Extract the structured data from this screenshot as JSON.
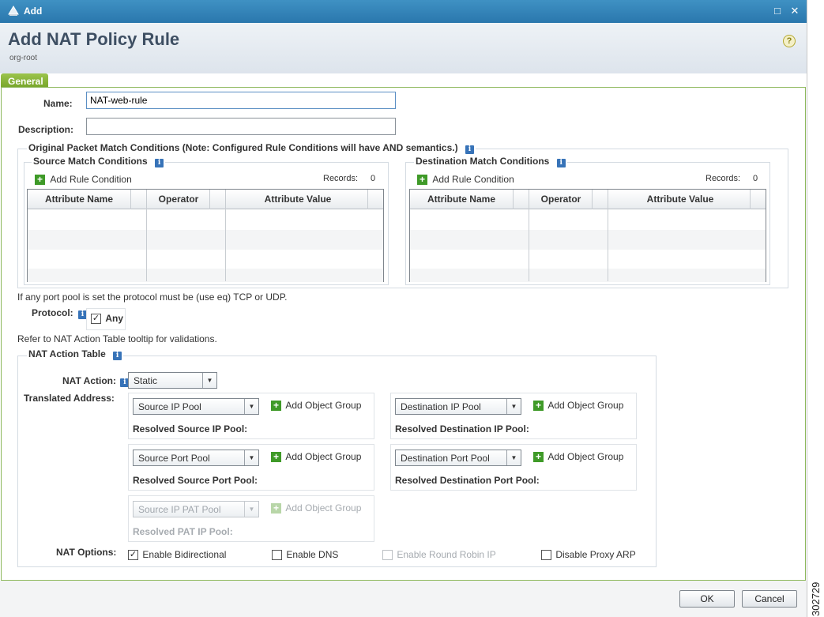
{
  "window": {
    "title": "Add"
  },
  "header": {
    "title": "Add NAT Policy Rule",
    "org": "org-root",
    "help": "?"
  },
  "tabs": [
    {
      "label": "General"
    }
  ],
  "form": {
    "name_label": "Name:",
    "name_value": "NAT-web-rule",
    "description_label": "Description:",
    "description_value": ""
  },
  "match": {
    "title": "Original Packet Match Conditions (Note: Configured Rule Conditions will have AND semantics.)",
    "source": {
      "title": "Source Match Conditions",
      "add_label": "Add Rule Condition",
      "records_label": "Records:",
      "records_count": "0",
      "columns": [
        "Attribute Name",
        "Operator",
        "Attribute Value"
      ]
    },
    "destination": {
      "title": "Destination Match Conditions",
      "add_label": "Add Rule Condition",
      "records_label": "Records:",
      "records_count": "0",
      "columns": [
        "Attribute Name",
        "Operator",
        "Attribute Value"
      ]
    }
  },
  "protocol": {
    "note": "If any port pool is set the protocol must be (use eq) TCP or UDP.",
    "label": "Protocol:",
    "any_label": "Any",
    "any_checked": true
  },
  "nat": {
    "tooltip_note": "Refer to NAT Action Table tooltip for validations.",
    "table_title": "NAT Action Table",
    "action_label": "NAT Action:",
    "action_value": "Static",
    "translated_label": "Translated Address:",
    "add_group_label": "Add Object Group",
    "source_ip_pool": "Source IP Pool",
    "resolved_source_ip": "Resolved Source IP Pool:",
    "dest_ip_pool": "Destination IP Pool",
    "resolved_dest_ip": "Resolved Destination IP Pool:",
    "source_port_pool": "Source Port Pool",
    "resolved_source_port": "Resolved Source Port Pool:",
    "dest_port_pool": "Destination Port Pool",
    "resolved_dest_port": "Resolved Destination Port Pool:",
    "source_pat_pool": "Source IP PAT Pool",
    "resolved_pat": "Resolved PAT IP Pool:",
    "options_label": "NAT Options:",
    "options": [
      {
        "label": "Enable Bidirectional",
        "checked": true,
        "disabled": false
      },
      {
        "label": "Enable DNS",
        "checked": false,
        "disabled": false
      },
      {
        "label": "Enable Round Robin IP",
        "checked": false,
        "disabled": true
      },
      {
        "label": "Disable Proxy ARP",
        "checked": false,
        "disabled": false
      }
    ]
  },
  "footer": {
    "ok_label": "OK",
    "cancel_label": "Cancel"
  },
  "figure_id": "302729",
  "colors": {
    "titlebar": "#2f7fb5",
    "tab": "#86b43a",
    "panel_border": "#8db85c",
    "info": "#3773b8",
    "add": "#3f9a28"
  }
}
